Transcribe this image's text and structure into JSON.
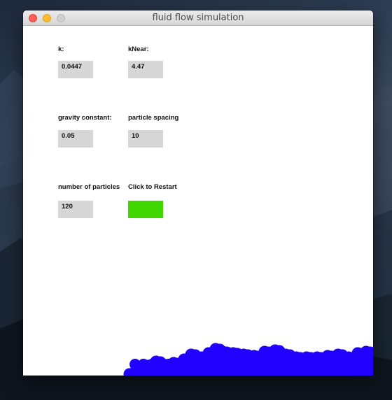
{
  "window": {
    "title": "fluid flow simulation"
  },
  "controls": {
    "k": {
      "label": "k:",
      "value": "0.0447"
    },
    "k_near": {
      "label": "kNear:",
      "value": "4.47"
    },
    "gravity": {
      "label": "gravity constant:",
      "value": "0.05"
    },
    "spacing": {
      "label": "particle spacing",
      "value": "10"
    },
    "particles": {
      "label": "number of particles",
      "value": "120"
    },
    "restart": {
      "label": "Click to Restart",
      "color": "#42d600"
    }
  },
  "colors": {
    "fluid": "#2200ff",
    "field_bg": "#d7d7d7"
  }
}
